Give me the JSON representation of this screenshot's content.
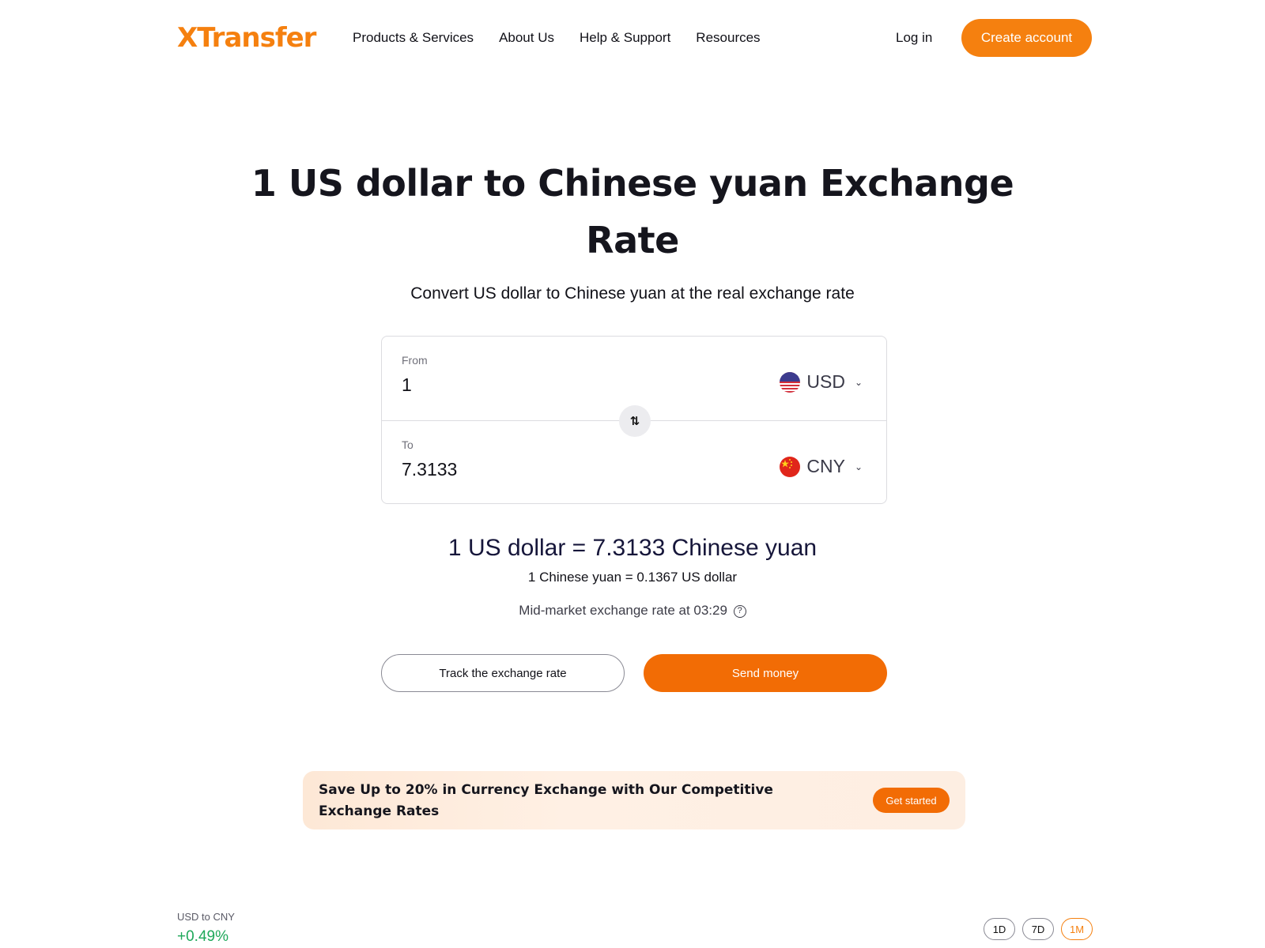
{
  "header": {
    "logo": "XTransfer",
    "nav": [
      {
        "label": "Products & Services"
      },
      {
        "label": "About Us"
      },
      {
        "label": "Help & Support"
      },
      {
        "label": "Resources"
      }
    ],
    "login_label": "Log in",
    "create_account_label": "Create account",
    "brand_color": "#f5800f"
  },
  "hero": {
    "title": "1 US dollar to Chinese yuan Exchange Rate",
    "subtitle": "Convert US dollar to Chinese yuan at the real exchange rate"
  },
  "converter": {
    "from": {
      "label": "From",
      "value": "1",
      "currency": "USD",
      "flag_icon": "us-flag-icon"
    },
    "to": {
      "label": "To",
      "value": "7.3133",
      "currency": "CNY",
      "flag_icon": "cn-flag-icon"
    },
    "swap_icon": "swap-arrows-icon",
    "swap_glyph": "⇅"
  },
  "rate": {
    "main": "1 US dollar = 7.3133 Chinese yuan",
    "inverse": "1 Chinese yuan = 0.1367 US dollar",
    "time_text": "Mid-market exchange rate at 03:29",
    "help_glyph": "?"
  },
  "actions": {
    "track_label": "Track the exchange rate",
    "send_label": "Send money",
    "send_color": "#f26c05"
  },
  "promo": {
    "text": "Save Up to 20% in Currency Exchange with Our Competitive Exchange Rates",
    "button_label": "Get started"
  },
  "chart_header": {
    "pair": "USD to CNY",
    "change": "+0.49%",
    "change_color": "#1fa85a",
    "ranges": [
      {
        "label": "1D",
        "active": false
      },
      {
        "label": "7D",
        "active": false
      },
      {
        "label": "1M",
        "active": true
      }
    ]
  }
}
